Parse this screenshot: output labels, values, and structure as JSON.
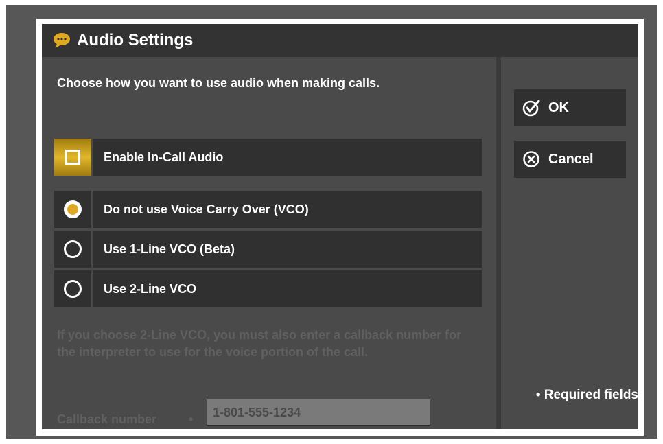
{
  "dialog": {
    "title": "Audio Settings",
    "title_icon": "chat-bubble-icon",
    "accent_color": "#e0a924"
  },
  "main": {
    "prompt": "Choose how you want to use audio when making calls.",
    "enable_audio": {
      "label": "Enable In-Call Audio",
      "checked": false
    },
    "vco_options": [
      {
        "label": "Do not use Voice Carry Over (VCO)",
        "selected": true
      },
      {
        "label": "Use 1-Line VCO (Beta)",
        "selected": false
      },
      {
        "label": "Use 2-Line VCO",
        "selected": false
      }
    ],
    "help_text": "If you choose 2-Line VCO, you must also enter a callback number for the interpreter to use for the voice portion of the call.",
    "callback": {
      "label": "Callback number",
      "required_marker": "•",
      "value": "1-801-555-1234"
    }
  },
  "side": {
    "ok_label": "OK",
    "cancel_label": "Cancel",
    "required_note": "• Required fields"
  }
}
